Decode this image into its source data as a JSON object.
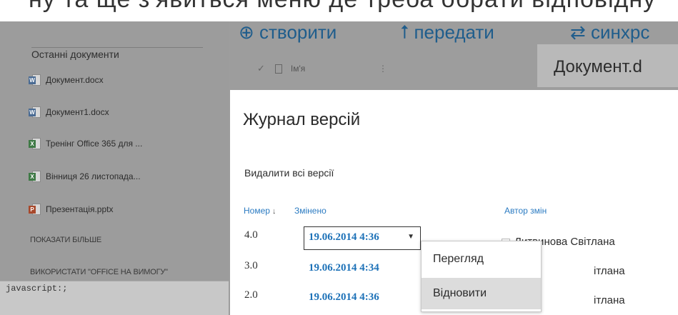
{
  "top_strip_text": "ну та ще з'явиться меню де треба обрати відповідну",
  "sidebar": {
    "heading": "Останні документи",
    "recent": [
      {
        "label": "Документ.docx",
        "icon": "word-doc-icon",
        "badge": "W"
      },
      {
        "label": "Документ1.docx",
        "icon": "word-doc-icon",
        "badge": "W"
      },
      {
        "label": "Тренінг Office 365 для ...",
        "icon": "excel-doc-icon",
        "badge": "X"
      },
      {
        "label": "Вінниця 26 листопада...",
        "icon": "excel-doc-icon",
        "badge": "X"
      },
      {
        "label": "Презентація.pptx",
        "icon": "powerpoint-doc-icon",
        "badge": "P"
      }
    ],
    "show_more": "ПОКАЗАТИ БІЛЬШЕ",
    "use_office": "ВИКОРИСТАТИ \"OFFICE НА ВИМОГУ\""
  },
  "status_bar": "javascript:;",
  "commands": {
    "create": "⊕ створити",
    "upload": "⭡ передати",
    "sync": "⇄ синхрс"
  },
  "list_header": {
    "check": "✓",
    "name": "Ім'я",
    "dots": "⋮"
  },
  "document_panel_title": "Документ.d",
  "dialog": {
    "title": "Журнал версій",
    "delete_all": "Видалити всі версії",
    "columns": {
      "number": "Номер",
      "sort_icon": "↓",
      "modified": "Змінено",
      "author": "Автор змін"
    },
    "rows": [
      {
        "number": "4.0",
        "modified": "19.06.2014 4:36",
        "author": "Литвинова Світлана"
      },
      {
        "number": "3.0",
        "modified": "19.06.2014 4:34",
        "author": "ітлана"
      },
      {
        "number": "2.0",
        "modified": "19.06.2014 4:36",
        "author": "ітлана"
      }
    ]
  },
  "context_menu": {
    "items": [
      "Перегляд",
      "Відновити"
    ]
  }
}
